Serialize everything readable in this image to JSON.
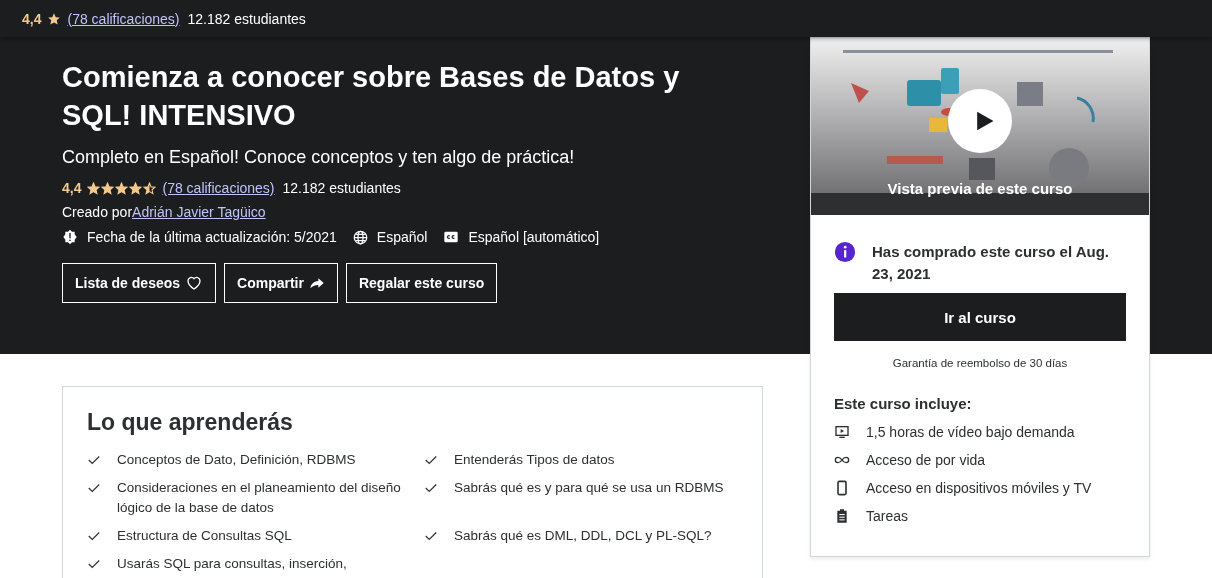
{
  "top_bar": {
    "rating": "4,4",
    "ratings_link": "(78 calificaciones)",
    "students": "12.182 estudiantes"
  },
  "course": {
    "title": "Comienza a conocer sobre Bases de Datos y SQL! INTENSIVO",
    "subtitle": "Completo en Español! Conoce conceptos y ten algo de práctica!",
    "rating": "4,4",
    "stars": 4.5,
    "ratings_link": "(78 calificaciones)",
    "students": "12.182 estudiantes",
    "created_by_label": "Creado por",
    "author": "Adrián Javier Tagüico",
    "meta": [
      {
        "kind": "updated",
        "text": "Fecha de la última actualización: 5/2021"
      },
      {
        "kind": "language",
        "text": "Español"
      },
      {
        "kind": "captions",
        "text": "Español [automático]"
      }
    ],
    "buttons": [
      {
        "kind": "wishlist",
        "label": "Lista de deseos"
      },
      {
        "kind": "share",
        "label": "Compartir"
      },
      {
        "kind": "gift",
        "label": "Regalar este curso"
      }
    ]
  },
  "sidebar": {
    "preview": {
      "kind": "picture",
      "caption": "Vista previa de este curso"
    },
    "purchase_notice": "Has comprado este curso el Aug. 23, 2021",
    "go_button": "Ir al curso",
    "guarantee": "Garantía de reembolso de 30 días",
    "includes_title": "Este curso incluye:",
    "includes": [
      {
        "kind": "video",
        "text": "1,5 horas de vídeo bajo demanda"
      },
      {
        "kind": "lifetime",
        "text": "Acceso de por vida"
      },
      {
        "kind": "mobile",
        "text": "Acceso en dispositivos móviles y TV"
      },
      {
        "kind": "assignments",
        "text": "Tareas"
      }
    ]
  },
  "learn": {
    "title": "Lo que aprenderás",
    "items": [
      "Conceptos de Dato, Definición, RDBMS",
      "Entenderás Tipos de datos",
      "Consideraciones en el planeamiento del diseño lógico de la base de datos",
      "Sabrás qué es y para qué se usa un RDBMS",
      "Estructura de Consultas SQL",
      "Sabrás qué es DML, DDL, DCL y PL-SQL?",
      "Usarás SQL para consultas, inserción,"
    ]
  }
}
